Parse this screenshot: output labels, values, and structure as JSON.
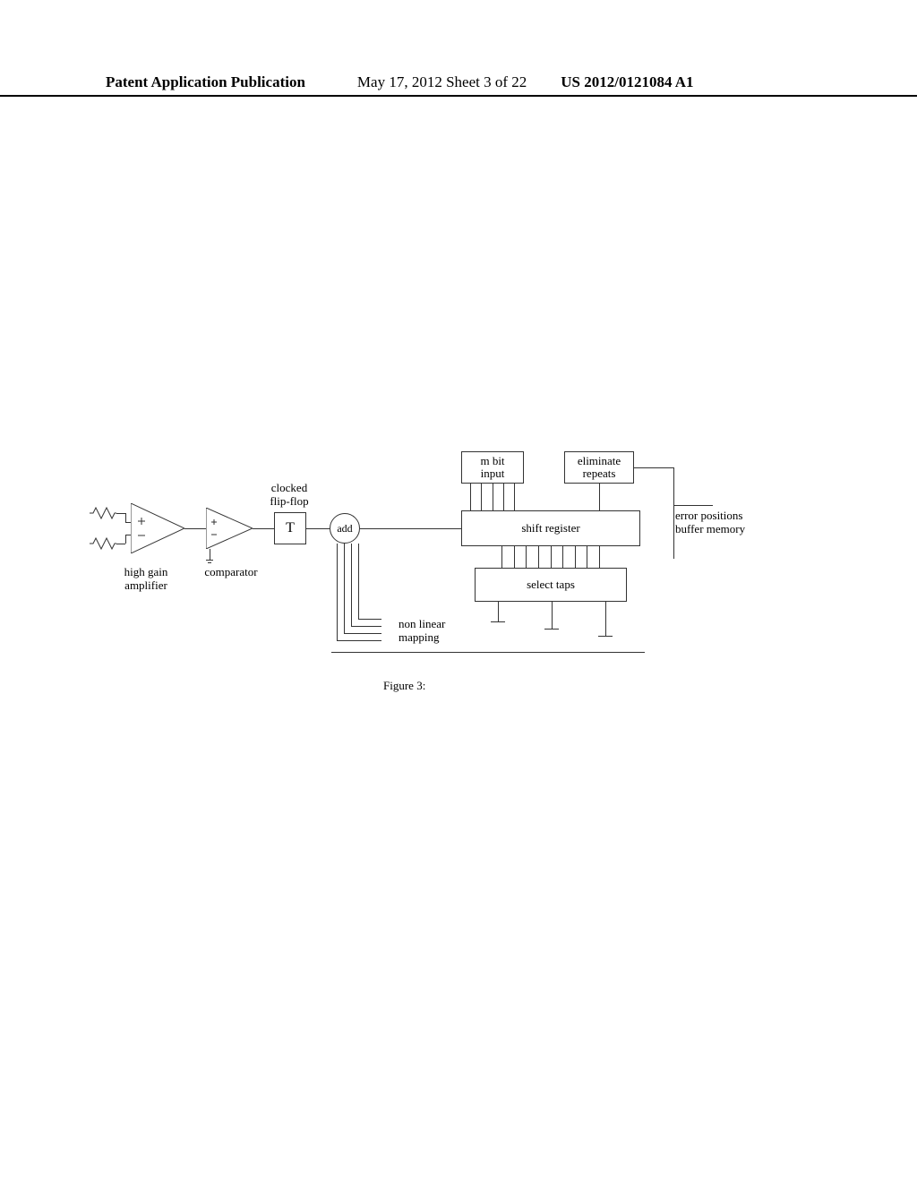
{
  "header": {
    "doc_type": "Patent Application Publication",
    "date": "May 17, 2012  Sheet 3 of 22",
    "pub_num": "US 2012/0121084 A1"
  },
  "diagram": {
    "amp_label": "high gain\namplifier",
    "comparator_label": "comparator",
    "flipflop_label": "clocked\nflip-flop",
    "flipflop_box": "T",
    "add_label": "add",
    "mbit_input_box": "m bit\ninput",
    "eliminate_box": "eliminate\nrepeats",
    "shift_register_box": "shift register",
    "select_taps_box": "select taps",
    "nonlinear_label": "non linear\nmapping",
    "buffer_label": "error positions\nbuffer memory"
  },
  "caption": "Figure 3:"
}
